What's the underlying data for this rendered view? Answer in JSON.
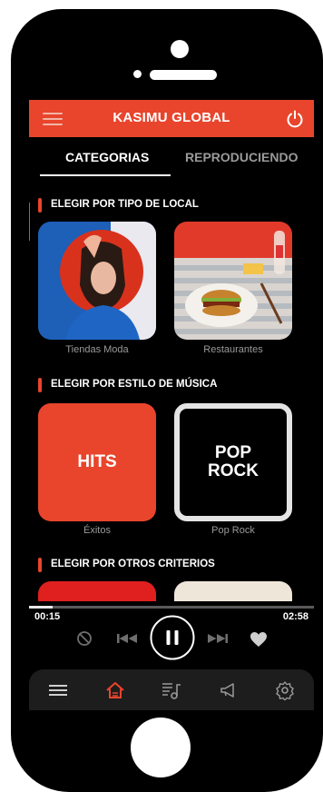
{
  "app_bar": {
    "title": "KASIMU GLOBAL"
  },
  "tabs": [
    {
      "label": "CATEGORIAS",
      "active": true
    },
    {
      "label": "REPRODUCIENDO",
      "active": false
    }
  ],
  "sections": [
    {
      "title": "ELEGIR POR TIPO DE LOCAL",
      "items": [
        {
          "label": "Tiendas Moda"
        },
        {
          "label": "Restaurantes"
        }
      ]
    },
    {
      "title": "ELEGIR POR ESTILO DE MÚSICA",
      "items": [
        {
          "label": "Éxitos",
          "tile_text": "HITS"
        },
        {
          "label": "Pop Rock",
          "tile_text_line1": "POP",
          "tile_text_line2": "ROCK"
        }
      ]
    },
    {
      "title": "ELEGIR POR OTROS CRITERIOS",
      "items": []
    }
  ],
  "player": {
    "elapsed": "00:15",
    "duration": "02:58",
    "progress": 0.084
  },
  "colors": {
    "accent": "#e8452c",
    "background": "#000000",
    "muted_text": "#9a9a9a",
    "navbar": "#1d1d1d"
  },
  "icons": {
    "app_bar": [
      "menu-icon",
      "power-icon"
    ],
    "player": [
      "block-icon",
      "previous-icon",
      "pause-icon",
      "next-icon",
      "heart-icon"
    ],
    "nav": [
      "menu-icon",
      "home-icon",
      "playlist-icon",
      "speaker-icon",
      "settings-icon"
    ]
  }
}
